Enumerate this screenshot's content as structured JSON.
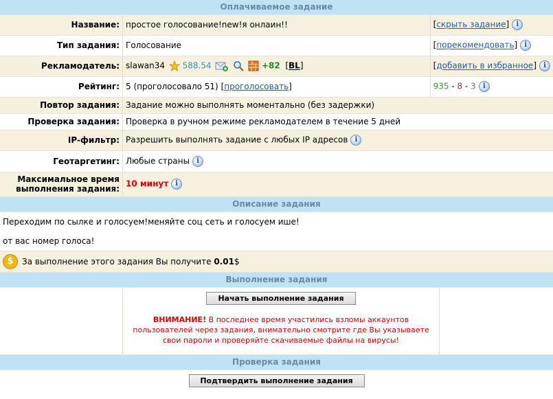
{
  "paid_task": {
    "header": "Оплачиваемое задание",
    "name": {
      "label": "Название:",
      "value": "простое голосование!new!я онлаин!!",
      "action": "скрыть задание"
    },
    "type": {
      "label": "Тип задания:",
      "value": "Голосование",
      "action": "порекомендовать"
    },
    "advertiser": {
      "label": "Рекламодатель:",
      "user": "slawan34",
      "balance": "588.54",
      "plus": "+82",
      "bl": "BL",
      "action": "добавить в избранное"
    },
    "rating": {
      "label": "Рейтинг:",
      "value": "5 (проголосовало 51)",
      "vote": "проголосовать",
      "r1": "935",
      "r2": "8",
      "r3": "3"
    },
    "repeat": {
      "label": "Повтор задания:",
      "value": "Задание можно выполнять моментально (без задержки)"
    },
    "check": {
      "label": "Проверка задания:",
      "value": "Проверка в ручном режиме рекламодателем в течение 5 дней"
    },
    "ip": {
      "label": "IP-фильтр:",
      "value": "Разрешить выполнять задание с любых IP адресов"
    },
    "geo": {
      "label": "Геотаргетинг:",
      "value": "Любые страны"
    },
    "maxtime": {
      "label1": "Максимальное время",
      "label2": "выполнения задания:",
      "value": "10 минут"
    }
  },
  "description": {
    "header": "Описание задания",
    "line1": "Переходим по сылке и голосуем!меняйте соц сеть и голосуем ише!",
    "line2": "от вас номер голоса!",
    "pay_text": "За выполнение этого задания Вы получите",
    "pay_amount": "0.01",
    "pay_currency": "$"
  },
  "execution": {
    "header": "Выполнение задания",
    "start_button": "Начать выполнение задания",
    "warn_title": "ВНИМАНИЕ!",
    "warn_text": "В последнее время участились взломы аккаунтов пользователей через задания, внимательно смотрите где Вы указываете свои пароли и проверяйте скачиваемые файлы на вирусы!"
  },
  "verify": {
    "header": "Проверка задания",
    "confirm_button": "Подтвердить выполнение задания"
  },
  "colors": {
    "section_bg": "#bfe3f5",
    "row_alt": "#f6f0df",
    "link": "#1e5bb3",
    "warning": "#e00000"
  }
}
